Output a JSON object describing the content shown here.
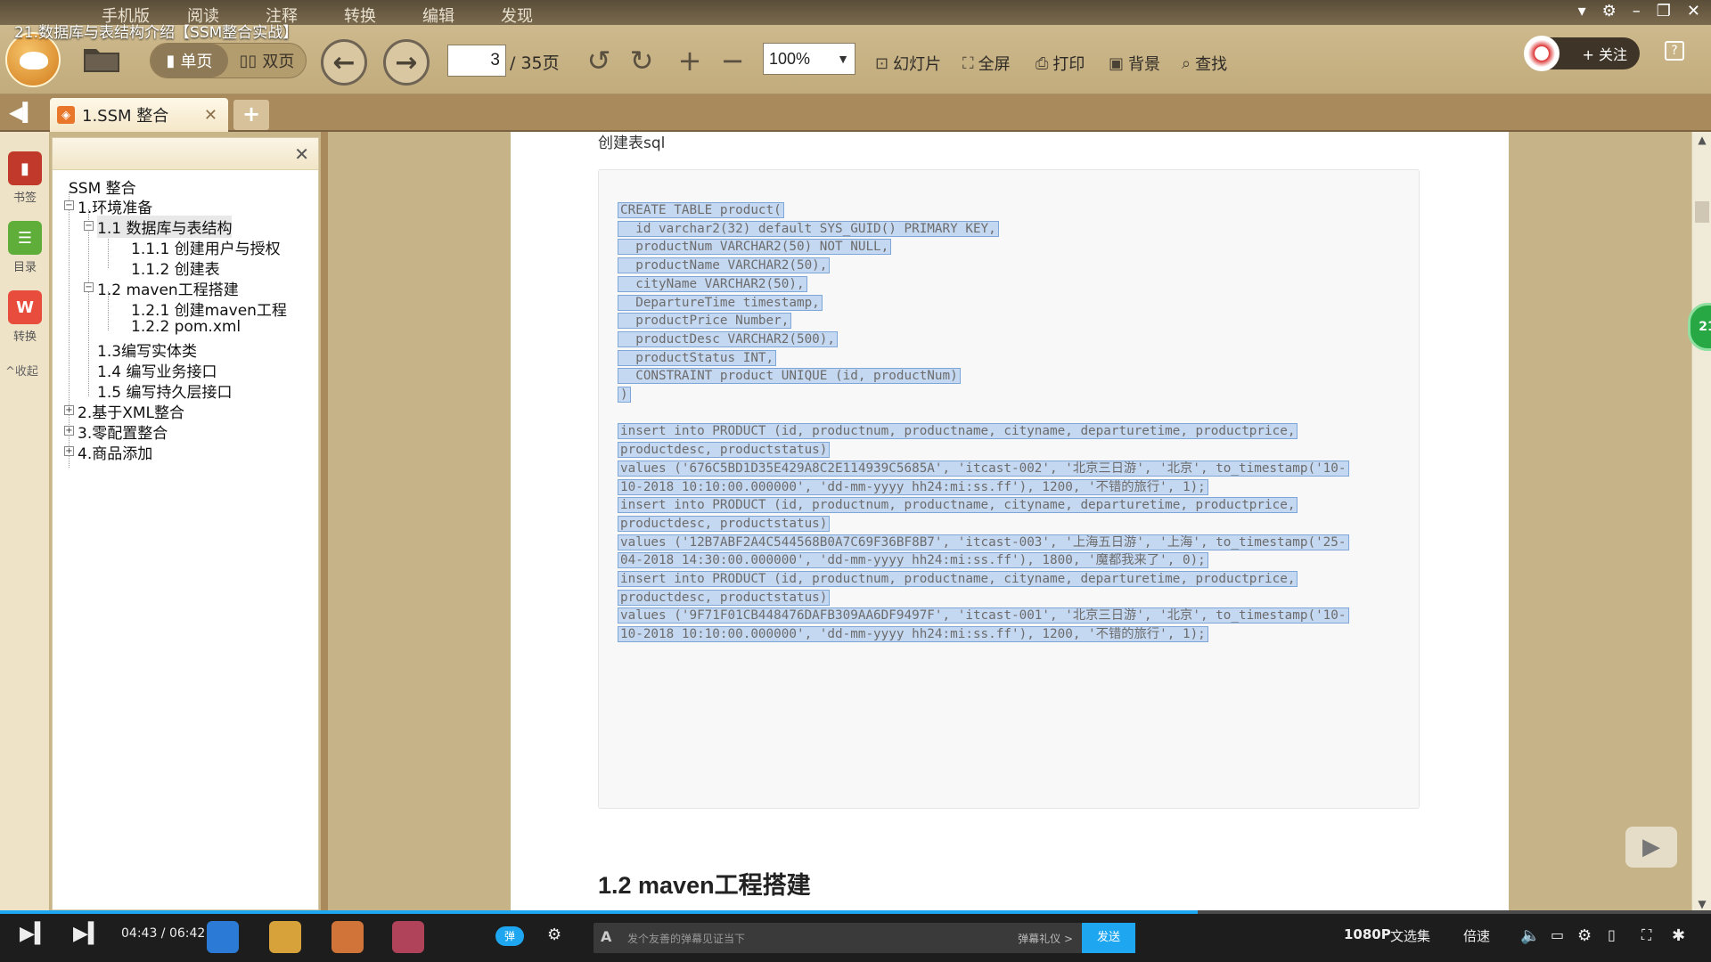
{
  "video": {
    "title": "21.数据库与表结构介绍【SSM整合实战】"
  },
  "menu": {
    "items": [
      "手机版",
      "阅读",
      "注释",
      "转换",
      "编辑",
      "发现"
    ]
  },
  "toolbar": {
    "single_label": "单页",
    "double_label": "双页",
    "page_current": "3",
    "page_total": "/ 35页",
    "zoom": "100%",
    "slideshow_label": "幻灯片",
    "fullscreen_label": "全屏",
    "print_label": "打印",
    "background_label": "背景",
    "find_label": "查找",
    "follow_label": "+ 关注"
  },
  "tab": {
    "title": "1.SSM 整合"
  },
  "side_tools": {
    "bookmark": "书签",
    "toc": "目录",
    "convert": "转换",
    "collapse": "收起"
  },
  "outline": {
    "items": [
      {
        "label": "SSM 整合"
      },
      {
        "label": "1.环境准备",
        "toggle": "−"
      },
      {
        "label": "1.1 数据库与表结构",
        "toggle": "−"
      },
      {
        "label": "1.1.1 创建用户与授权"
      },
      {
        "label": "1.1.2 创建表"
      },
      {
        "label": "1.2 maven工程搭建",
        "toggle": "−"
      },
      {
        "label": "1.2.1 创建maven工程"
      },
      {
        "label": "1.2.2 pom.xml"
      },
      {
        "label": "1.3编写实体类"
      },
      {
        "label": "1.4 编写业务接口"
      },
      {
        "label": "1.5 编写持久层接口"
      },
      {
        "label": "2.基于XML整合",
        "toggle": "+"
      },
      {
        "label": "3.零配置整合",
        "toggle": "+"
      },
      {
        "label": "4.商品添加",
        "toggle": "+"
      }
    ]
  },
  "document": {
    "caption": "创建表sql",
    "code_lines": [
      "CREATE TABLE product(",
      "  id varchar2(32) default SYS_GUID() PRIMARY KEY,",
      "  productNum VARCHAR2(50) NOT NULL,",
      "  productName VARCHAR2(50),",
      "  cityName VARCHAR2(50),",
      "  DepartureTime timestamp,",
      "  productPrice Number,",
      "  productDesc VARCHAR2(500),",
      "  productStatus INT,",
      "  CONSTRAINT product UNIQUE (id, productNum)",
      ")",
      "",
      "insert into PRODUCT (id, productnum, productname, cityname, departuretime, productprice,",
      "productdesc, productstatus)",
      "values ('676C5BD1D35E429A8C2E114939C5685A', 'itcast-002', '北京三日游', '北京', to_timestamp('10-",
      "10-2018 10:10:00.000000', 'dd-mm-yyyy hh24:mi:ss.ff'), 1200, '不错的旅行', 1);",
      "insert into PRODUCT (id, productnum, productname, cityname, departuretime, productprice,",
      "productdesc, productstatus)",
      "values ('12B7ABF2A4C544568B0A7C69F36BF8B7', 'itcast-003', '上海五日游', '上海', to_timestamp('25-",
      "04-2018 14:30:00.000000', 'dd-mm-yyyy hh24:mi:ss.ff'), 1800, '魔都我来了', 0);",
      "insert into PRODUCT (id, productnum, productname, cityname, departuretime, productprice,",
      "productdesc, productstatus)",
      "values ('9F71F01CB448476DAFB309AA6DF9497F', 'itcast-001', '北京三日游', '北京', to_timestamp('10-",
      "10-2018 10:10:00.000000', 'dd-mm-yyyy hh24:mi:ss.ff'), 1200, '不错的旅行', 1);"
    ],
    "next_heading": "1.2 maven工程搭建"
  },
  "side_badge": "21",
  "player": {
    "time": "04:43 / 06:42",
    "progress": 0.7,
    "danmaku_placeholder": "发个友善的弹幕见证当下",
    "danmaku_etiquette": "弹幕礼仪 >",
    "send_label": "发送",
    "quality": "1080P",
    "anthology": "文选集",
    "speed": "倍速"
  },
  "colors": {
    "accent": "#1ea7f0",
    "toolbar_bg": "#c9b58a",
    "selection": "#c5d8f2"
  }
}
